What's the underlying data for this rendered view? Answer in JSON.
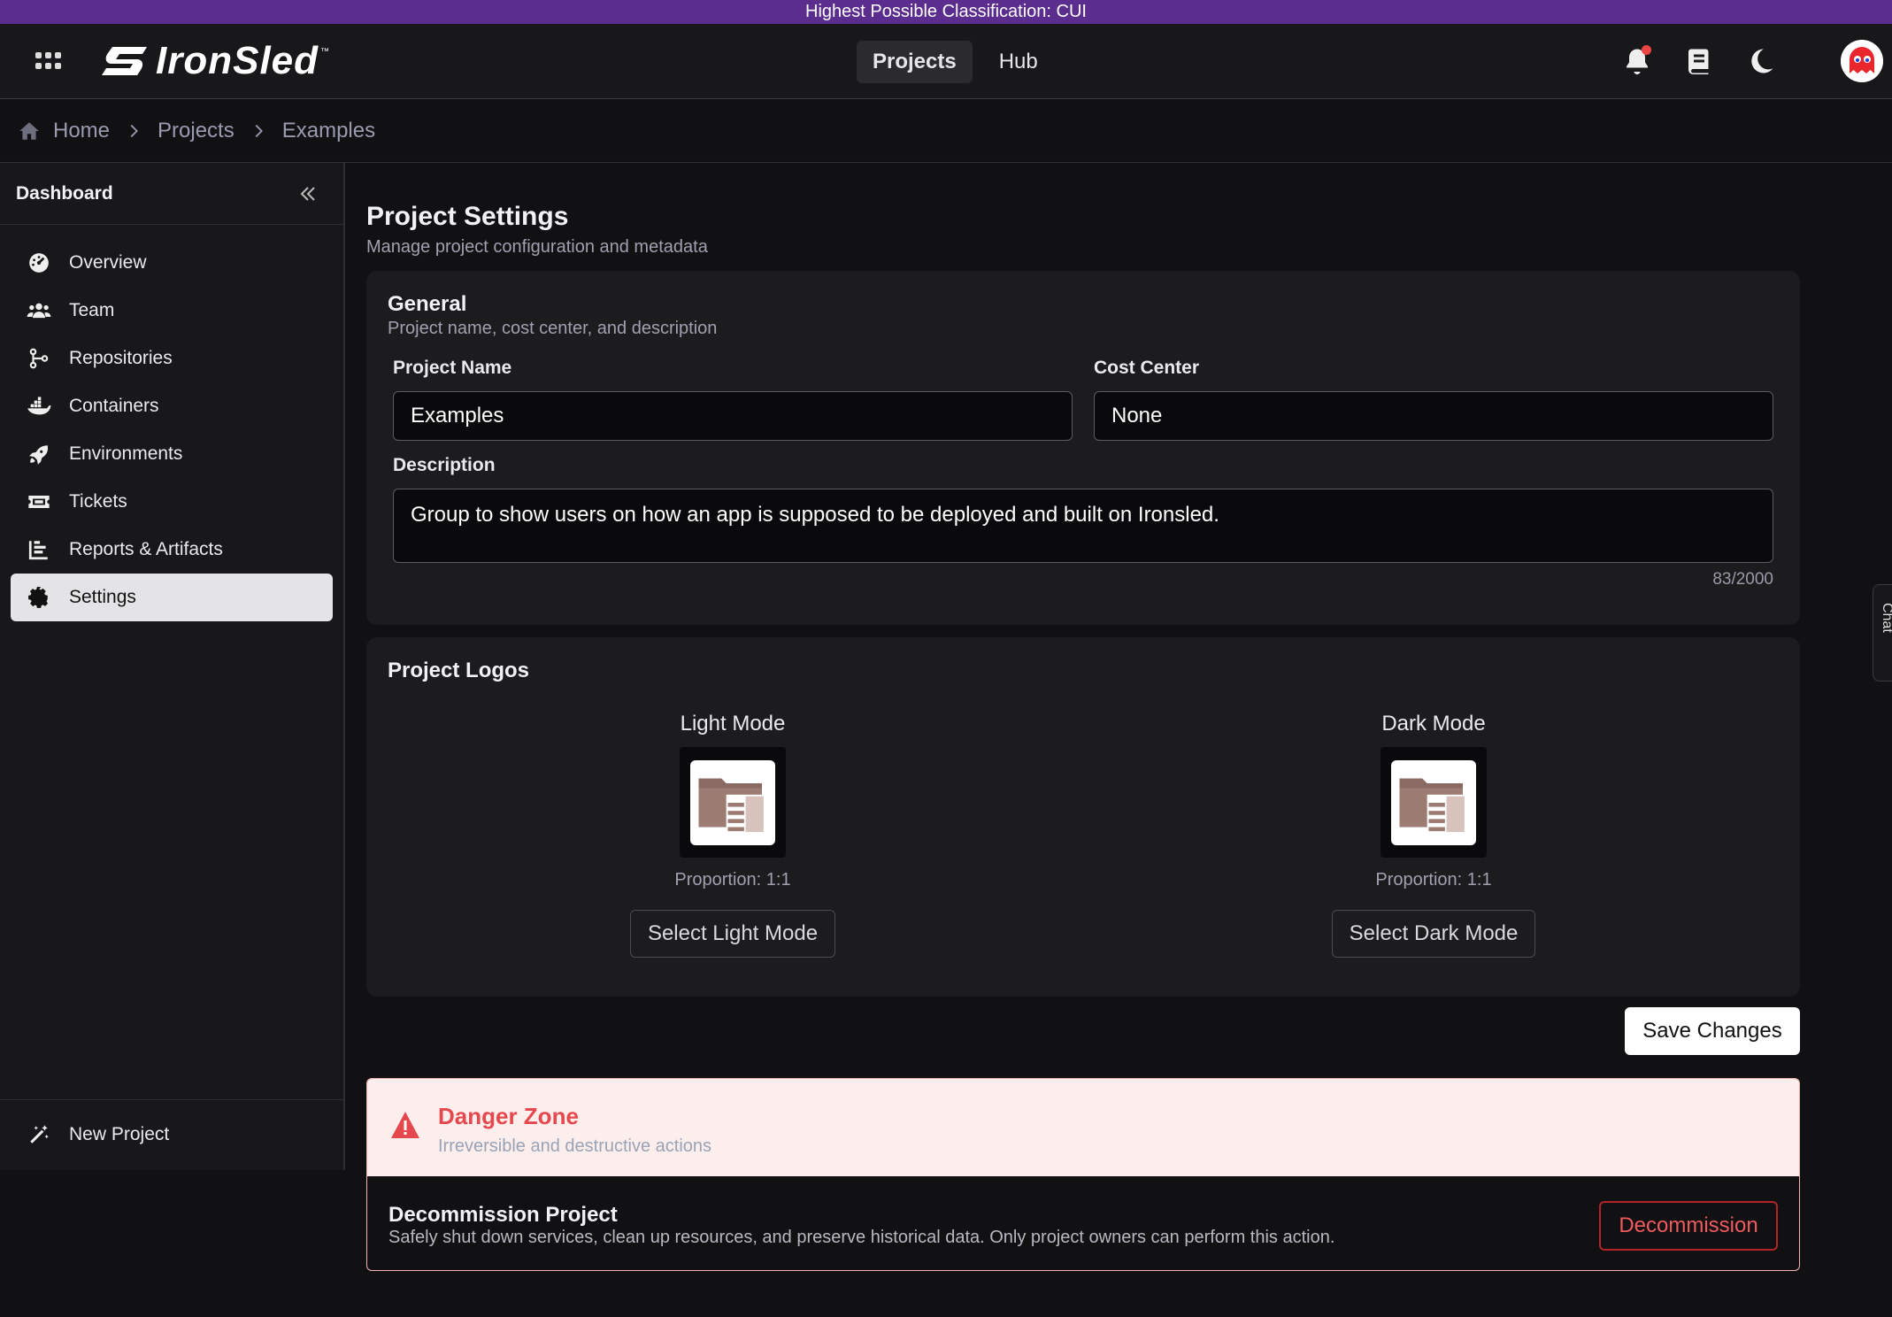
{
  "classification": "Highest Possible Classification: CUI",
  "brand": {
    "name": "IronSled",
    "tm": "™"
  },
  "topnav": [
    {
      "label": "Projects",
      "active": true
    },
    {
      "label": "Hub",
      "active": false
    }
  ],
  "top_icons": [
    "notifications-bell-icon",
    "docs-book-icon",
    "theme-moon-icon"
  ],
  "breadcrumb": [
    "Home",
    "Projects",
    "Examples"
  ],
  "sidebar": {
    "title": "Dashboard",
    "items": [
      {
        "label": "Overview",
        "icon": "gauge-icon",
        "active": false
      },
      {
        "label": "Team",
        "icon": "users-icon",
        "active": false
      },
      {
        "label": "Repositories",
        "icon": "git-branch-icon",
        "active": false
      },
      {
        "label": "Containers",
        "icon": "docker-icon",
        "active": false
      },
      {
        "label": "Environments",
        "icon": "rocket-icon",
        "active": false
      },
      {
        "label": "Tickets",
        "icon": "ticket-icon",
        "active": false
      },
      {
        "label": "Reports & Artifacts",
        "icon": "bar-chart-icon",
        "active": false
      },
      {
        "label": "Settings",
        "icon": "gear-icon",
        "active": true
      }
    ],
    "footer": {
      "label": "New Project",
      "icon": "magic-wand-icon"
    }
  },
  "page": {
    "title": "Project Settings",
    "subtitle": "Manage project configuration and metadata"
  },
  "general": {
    "title": "General",
    "subtitle": "Project name, cost center, and description",
    "project_name_label": "Project Name",
    "project_name_value": "Examples",
    "cost_center_label": "Cost Center",
    "cost_center_value": "None",
    "description_label": "Description",
    "description_value": "Group to show users on how an app is supposed to be deployed and built on Ironsled.",
    "counter": "83/2000"
  },
  "logos": {
    "title": "Project Logos",
    "light": {
      "label": "Light Mode",
      "proportion": "Proportion: 1:1",
      "button": "Select Light Mode"
    },
    "dark": {
      "label": "Dark Mode",
      "proportion": "Proportion: 1:1",
      "button": "Select Dark Mode"
    }
  },
  "save_button": "Save Changes",
  "danger": {
    "title": "Danger Zone",
    "subtitle": "Irreversible and destructive actions",
    "action_title": "Decommission Project",
    "action_desc": "Safely shut down services, clean up resources, and preserve historical data. Only project owners can perform this action.",
    "action_button": "Decommission"
  },
  "chat_tab": "Chat",
  "colors": {
    "classification_bar": "#5b2d8e",
    "danger_red": "#e5484d",
    "notification_dot": "#ef4444"
  }
}
